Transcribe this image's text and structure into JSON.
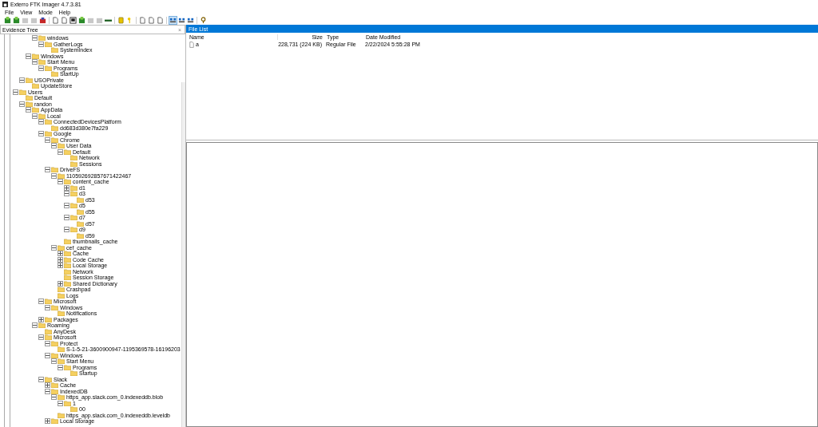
{
  "window": {
    "title": "Exterro FTK Imager 4.7.3.81"
  },
  "menu": [
    "File",
    "View",
    "Mode",
    "Help"
  ],
  "evidence_tree": {
    "title": "Evidence Tree",
    "close": "×",
    "items": [
      {
        "children": [
          {
            "children": [
              {
                "children": [
                  {
                    "label": "windows",
                    "expanded": true,
                    "children": [
                      {
                        "label": "GatherLogs",
                        "expanded": true,
                        "children": [
                          {
                            "label": "SystemIndex"
                          }
                        ]
                      }
                    ]
                  }
                ]
              },
              {
                "label": "Windows",
                "expanded": true,
                "children": [
                  {
                    "label": "Start Menu",
                    "expanded": true,
                    "children": [
                      {
                        "label": "Programs",
                        "expanded": true,
                        "children": [
                          {
                            "label": "StartUp"
                          }
                        ]
                      }
                    ]
                  }
                ]
              }
            ]
          },
          {
            "label": "USOPrivate",
            "expanded": true,
            "children": [
              {
                "label": "UpdateStore"
              }
            ]
          }
        ]
      },
      {
        "label": "Users",
        "expanded": true,
        "children": [
          {
            "label": "Default"
          },
          {
            "label": "randon",
            "expanded": true,
            "children": [
              {
                "label": "AppData",
                "expanded": true,
                "children": [
                  {
                    "label": "Local",
                    "expanded": true,
                    "children": [
                      {
                        "label": "ConnectedDevicesPlatform",
                        "expanded": true,
                        "children": [
                          {
                            "label": "dd683d380e7fa229"
                          }
                        ]
                      },
                      {
                        "label": "Google",
                        "expanded": true,
                        "children": [
                          {
                            "label": "Chrome",
                            "expanded": true,
                            "children": [
                              {
                                "label": "User Data",
                                "expanded": true,
                                "children": [
                                  {
                                    "label": "Default",
                                    "expanded": true,
                                    "children": [
                                      {
                                        "label": "Network"
                                      },
                                      {
                                        "label": "Sessions"
                                      }
                                    ]
                                  }
                                ]
                              }
                            ]
                          },
                          {
                            "label": "DriveFS",
                            "expanded": true,
                            "children": [
                              {
                                "label": "110592692857671422467",
                                "expanded": true,
                                "children": [
                                  {
                                    "label": "content_cache",
                                    "expanded": true,
                                    "children": [
                                      {
                                        "label": "d1",
                                        "expanded": false
                                      },
                                      {
                                        "label": "d3",
                                        "expanded": true,
                                        "children": [
                                          {
                                            "label": "d53"
                                          }
                                        ]
                                      },
                                      {
                                        "label": "d5",
                                        "expanded": true,
                                        "children": [
                                          {
                                            "label": "d55"
                                          }
                                        ]
                                      },
                                      {
                                        "label": "d7",
                                        "expanded": true,
                                        "children": [
                                          {
                                            "label": "d57"
                                          }
                                        ]
                                      },
                                      {
                                        "label": "d9",
                                        "expanded": true,
                                        "children": [
                                          {
                                            "label": "d59"
                                          }
                                        ]
                                      }
                                    ]
                                  },
                                  {
                                    "label": "thumbnails_cache"
                                  }
                                ]
                              },
                              {
                                "label": "cef_cache",
                                "expanded": true,
                                "children": [
                                  {
                                    "label": "Cache",
                                    "expanded": false
                                  },
                                  {
                                    "label": "Code Cache",
                                    "expanded": false
                                  },
                                  {
                                    "label": "Local Storage",
                                    "expanded": false
                                  },
                                  {
                                    "label": "Network"
                                  },
                                  {
                                    "label": "Session Storage"
                                  },
                                  {
                                    "label": "Shared Dictionary",
                                    "expanded": false
                                  }
                                ]
                              },
                              {
                                "label": "Crashpad"
                              },
                              {
                                "label": "Logs"
                              }
                            ]
                          }
                        ]
                      },
                      {
                        "label": "Microsoft",
                        "expanded": true,
                        "children": [
                          {
                            "label": "Windows",
                            "expanded": true,
                            "children": [
                              {
                                "label": "Notifications"
                              }
                            ]
                          }
                        ]
                      },
                      {
                        "label": "Packages",
                        "expanded": false
                      }
                    ]
                  },
                  {
                    "label": "Roaming",
                    "expanded": true,
                    "children": [
                      {
                        "label": "AnyDesk"
                      },
                      {
                        "label": "Microsoft",
                        "expanded": true,
                        "children": [
                          {
                            "label": "Protect",
                            "expanded": true,
                            "children": [
                              {
                                "label": "S-1-5-21-3600900947-1195369578-16196203"
                              }
                            ]
                          },
                          {
                            "label": "Windows",
                            "expanded": true,
                            "children": [
                              {
                                "label": "Start Menu",
                                "expanded": true,
                                "children": [
                                  {
                                    "label": "Programs",
                                    "expanded": true,
                                    "children": [
                                      {
                                        "label": "Startup"
                                      }
                                    ]
                                  }
                                ]
                              }
                            ]
                          }
                        ]
                      },
                      {
                        "label": "Slack",
                        "expanded": true,
                        "children": [
                          {
                            "label": "Cache",
                            "expanded": false
                          },
                          {
                            "label": "IndexedDB",
                            "expanded": true,
                            "children": [
                              {
                                "label": "https_app.slack.com_0.indexeddb.blob",
                                "expanded": true,
                                "children": [
                                  {
                                    "label": "1",
                                    "expanded": true,
                                    "children": [
                                      {
                                        "label": "00"
                                      }
                                    ]
                                  }
                                ]
                              },
                              {
                                "label": "https_app.slack.com_0.indexeddb.leveldb"
                              }
                            ]
                          },
                          {
                            "label": "Local Storage",
                            "expanded": false
                          }
                        ]
                      }
                    ]
                  }
                ]
              }
            ]
          }
        ]
      }
    ]
  },
  "file_list": {
    "title": "File List",
    "columns": [
      "Name",
      "Size",
      "Type",
      "Date Modified"
    ],
    "rows": [
      {
        "name": "a",
        "size": "228,731 (224 KB)",
        "type": "Regular File",
        "modified": "2/22/2024 5:55:28 PM"
      }
    ]
  }
}
